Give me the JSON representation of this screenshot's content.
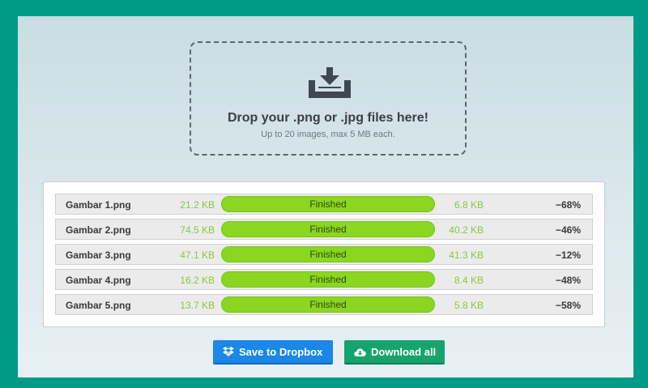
{
  "dropzone": {
    "icon": "download-tray-icon",
    "title": "Drop your .png or .jpg files here!",
    "subtitle": "Up to 20 images, max 5 MB each."
  },
  "files": [
    {
      "name": "Gambar 1.png",
      "original_size": "21.2 KB",
      "status": "Finished",
      "progress": 1.0,
      "new_size": "6.8 KB",
      "saving": "−68%"
    },
    {
      "name": "Gambar 2.png",
      "original_size": "74.5 KB",
      "status": "Finished",
      "progress": 1.0,
      "new_size": "40.2 KB",
      "saving": "−46%"
    },
    {
      "name": "Gambar 3.png",
      "original_size": "47.1 KB",
      "status": "Finished",
      "progress": 1.0,
      "new_size": "41.3 KB",
      "saving": "−12%"
    },
    {
      "name": "Gambar 4.png",
      "original_size": "16.2 KB",
      "status": "Finished",
      "progress": 1.0,
      "new_size": "8.4 KB",
      "saving": "−48%"
    },
    {
      "name": "Gambar 5.png",
      "original_size": "13.7 KB",
      "status": "Finished",
      "progress": 1.0,
      "new_size": "5.8 KB",
      "saving": "−58%"
    }
  ],
  "actions": {
    "dropbox_label": "Save to Dropbox",
    "dropbox_icon": "dropbox-icon",
    "download_label": "Download all",
    "download_icon": "cloud-download-icon"
  },
  "colors": {
    "frame": "#009a88",
    "size_text": "#8cc63e",
    "progress_fill": "#8ad621",
    "dropbox_button": "#1b87e6",
    "download_button": "#16a36f"
  }
}
